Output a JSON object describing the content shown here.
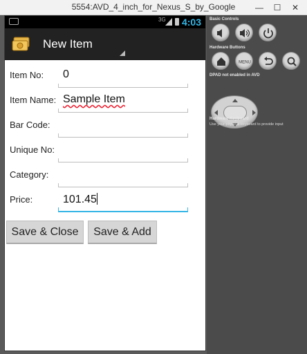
{
  "window": {
    "title": "5554:AVD_4_inch_for_Nexus_S_by_Google",
    "controls": [
      "—",
      "☐",
      "✕"
    ]
  },
  "statusbar": {
    "network": "3G",
    "time": "4:03"
  },
  "actionbar": {
    "title": "New Item"
  },
  "form": {
    "fields": [
      {
        "label": "Item No:",
        "value": "0"
      },
      {
        "label": "Item Name:",
        "value": "Sample Item"
      },
      {
        "label": "Bar Code:",
        "value": ""
      },
      {
        "label": "Unique No:",
        "value": ""
      },
      {
        "label": "Category:",
        "value": ""
      },
      {
        "label": "Price:",
        "value": "101.45"
      }
    ],
    "buttons": {
      "save_close": "Save & Close",
      "save_add": "Save & Add"
    }
  },
  "controls": {
    "basic_title": "Basic Controls",
    "hardware_title": "Hardware Buttons",
    "menu_label": "MENU",
    "dpad_note": "DPAD not enabled in AVD",
    "keyboard_title": "Hardware Keyboard",
    "keyboard_note": "Use your physical keyboard to provide input"
  },
  "colors": {
    "accent": "#33b5e5",
    "actionbar": "#222222",
    "panel": "#4b4b4b"
  }
}
